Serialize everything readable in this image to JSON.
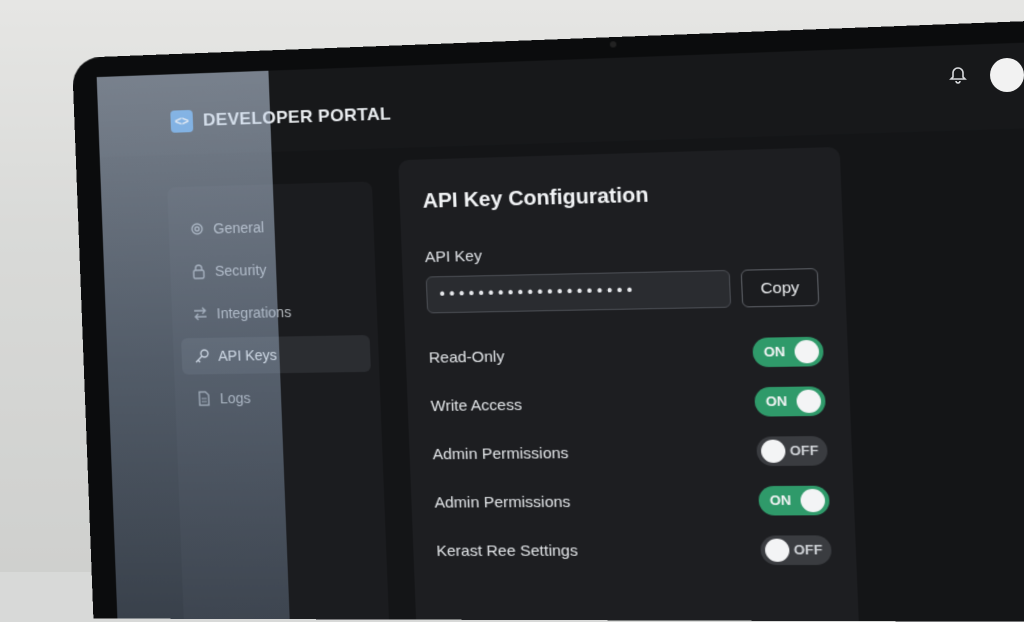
{
  "brand": {
    "title": "DEVELOPER PORTAL",
    "logo_glyph": "<>",
    "logo_color": "#3a8fe0"
  },
  "header": {
    "icons": [
      "bell-icon",
      "avatar"
    ]
  },
  "sidebar": {
    "items": [
      {
        "label": "General",
        "icon": "gear-icon",
        "active": false
      },
      {
        "label": "Security",
        "icon": "lock-icon",
        "active": false
      },
      {
        "label": "Integrations",
        "icon": "swap-arrows-icon",
        "active": false
      },
      {
        "label": "API Keys",
        "icon": "key-icon",
        "active": true
      },
      {
        "label": "Logs",
        "icon": "document-icon",
        "active": false
      }
    ]
  },
  "panel": {
    "title": "API Key Configuration",
    "api_key_label": "API Key",
    "api_key_value": "••••••••••••••••••••",
    "copy_label": "Copy",
    "toggles": [
      {
        "label": "Read-Only",
        "state": "ON"
      },
      {
        "label": "Write Access",
        "state": "ON"
      },
      {
        "label": "Admin Permissions",
        "state": "OFF"
      },
      {
        "label": "Admin Permissions",
        "state": "ON"
      },
      {
        "label": "Kerast Ree Settings",
        "state": "OFF"
      }
    ]
  },
  "colors": {
    "toggle_on": "#2f9a6a",
    "toggle_off": "#3a3c40",
    "accent": "#3a8fe0"
  }
}
